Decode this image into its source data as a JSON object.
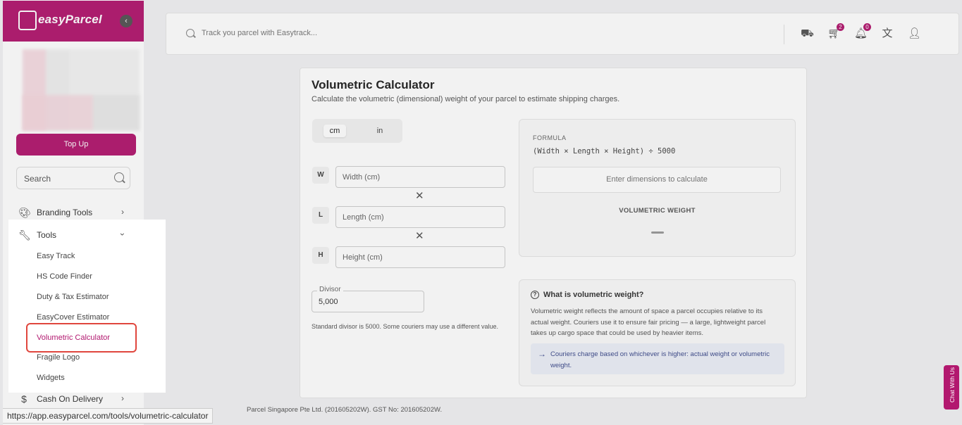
{
  "brand": {
    "logo_text": "easyParcel",
    "accent": "#b2186f"
  },
  "sidebar": {
    "topup_label": "Top Up",
    "search_placeholder": "Search",
    "items": [
      {
        "label": "Branding Tools",
        "icon": "palette-icon"
      },
      {
        "label": "Tools",
        "icon": "wrench-icon"
      },
      {
        "label": "Cash On Delivery",
        "icon": "dollar-icon"
      }
    ],
    "tools_sub": [
      "Easy Track",
      "HS Code Finder",
      "Duty & Tax Estimator",
      "EasyCover Estimator",
      "Volumetric Calculator",
      "Fragile Logo",
      "Widgets"
    ],
    "active_sub": "Volumetric Calculator"
  },
  "topbar": {
    "search_placeholder": "Track you parcel with Easytrack...",
    "cart_badge": "2",
    "bell_badge": "0"
  },
  "calculator": {
    "title": "Volumetric Calculator",
    "subtitle": "Calculate the volumetric (dimensional) weight of your parcel to estimate shipping charges.",
    "units": [
      "cm",
      "in"
    ],
    "selected_unit": "cm",
    "dims": [
      {
        "letter": "W",
        "placeholder": "Width (cm)"
      },
      {
        "letter": "L",
        "placeholder": "Length (cm)"
      },
      {
        "letter": "H",
        "placeholder": "Height (cm)"
      }
    ],
    "times_glyph": "✕",
    "divisor_label": "Divisor",
    "divisor_value": "5,000",
    "divisor_note": "Standard divisor is 5000. Some couriers may use a different value.",
    "formula_label": "FORMULA",
    "formula_expr": "(Width × Length × Height) ÷ 5000",
    "formula_placeholder": "Enter dimensions to calculate",
    "vw_label": "VOLUMETRIC WEIGHT"
  },
  "info": {
    "title": "What is volumetric weight?",
    "text": "Volumetric weight reflects the amount of space a parcel occupies relative to its actual weight. Couriers use it to ensure fair pricing — a large, lightweight parcel takes up cargo space that could be used by heavier items.",
    "note": "Couriers charge based on whichever is higher: actual weight or volumetric weight."
  },
  "footer": {
    "text": "Parcel Singapore Pte Ltd. (201605202W). GST No: 201605202W."
  },
  "status_url": "https://app.easyparcel.com/tools/volumetric-calculator",
  "chat_label": "Chat With Us"
}
